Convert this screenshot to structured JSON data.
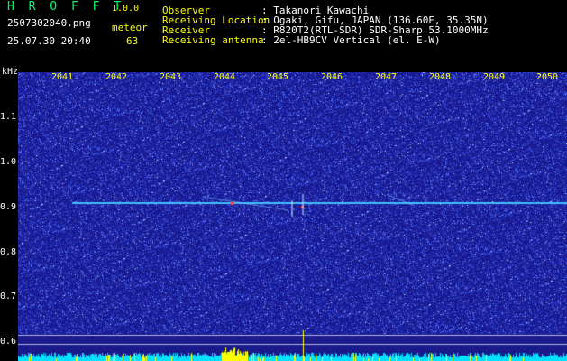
{
  "header": {
    "app_title": "H R O F F T",
    "version": "1.0.0",
    "filename": "2507302040.png",
    "timestamp": "25.07.30 20:40",
    "detect_label": "meteor",
    "detect_count": "63"
  },
  "station": [
    {
      "key": "Observer",
      "value": ": Takanori Kawachi"
    },
    {
      "key": "Receiving Location",
      "value": ": Ogaki, Gifu, JAPAN (136.60E, 35.35N)"
    },
    {
      "key": "Receiver",
      "value": ": R820T2(RTL-SDR) SDR-Sharp 53.1000MHz"
    },
    {
      "key": "Receiving antenna",
      "value": ": 2el-HB9CV Vertical (el. E-W)"
    }
  ],
  "axis": {
    "y_unit": "kHz",
    "x_ticks": [
      "2041",
      "2042",
      "2043",
      "2044",
      "2045",
      "2046",
      "2047",
      "2048",
      "2049",
      "2050"
    ],
    "y_ticks": [
      "1.1",
      "1.0",
      "0.9",
      "0.8",
      "0.7",
      "0.6"
    ]
  },
  "colors": {
    "background": "#1a1a8c",
    "noise": "#4a6aff",
    "signal": "#40c0ff",
    "meteor": "#ff4040",
    "level_bar": "#00e0ff",
    "level_peak": "#ffff00",
    "tick_x": "#ffff00",
    "tick_y": "#ffffff"
  }
}
